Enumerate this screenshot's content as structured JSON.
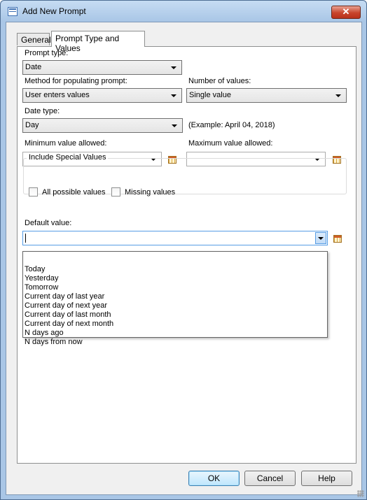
{
  "window": {
    "title": "Add New Prompt",
    "close_glyph": "✕"
  },
  "tabs": [
    {
      "label": "General"
    },
    {
      "label": "Prompt Type and Values"
    }
  ],
  "prompt_type": {
    "label": "Prompt type:",
    "value": "Date"
  },
  "method": {
    "label": "Method for populating prompt:",
    "value": "User enters values"
  },
  "number_of_values": {
    "label": "Number of values:",
    "value": "Single value"
  },
  "date_type": {
    "label": "Date type:",
    "value": "Day",
    "example": "(Example: April 04, 2018)"
  },
  "min_value": {
    "label": "Minimum value allowed:",
    "value": ""
  },
  "max_value": {
    "label": "Maximum value allowed:",
    "value": ""
  },
  "special_values": {
    "title": "Include Special Values",
    "all_possible": "All possible values",
    "missing": "Missing values"
  },
  "default_value": {
    "label": "Default value:",
    "value": "",
    "options": [
      "",
      "Today",
      "Yesterday",
      "Tomorrow",
      "Current day of last year",
      "Current day of next year",
      "Current day of last month",
      "Current day of next month",
      "N days ago",
      "N days from now"
    ]
  },
  "buttons": {
    "ok": "OK",
    "cancel": "Cancel",
    "help": "Help"
  },
  "icons": {
    "title": "window-app-icon",
    "calendar": "calendar-icon",
    "dropdown": "chevron-down-icon"
  }
}
